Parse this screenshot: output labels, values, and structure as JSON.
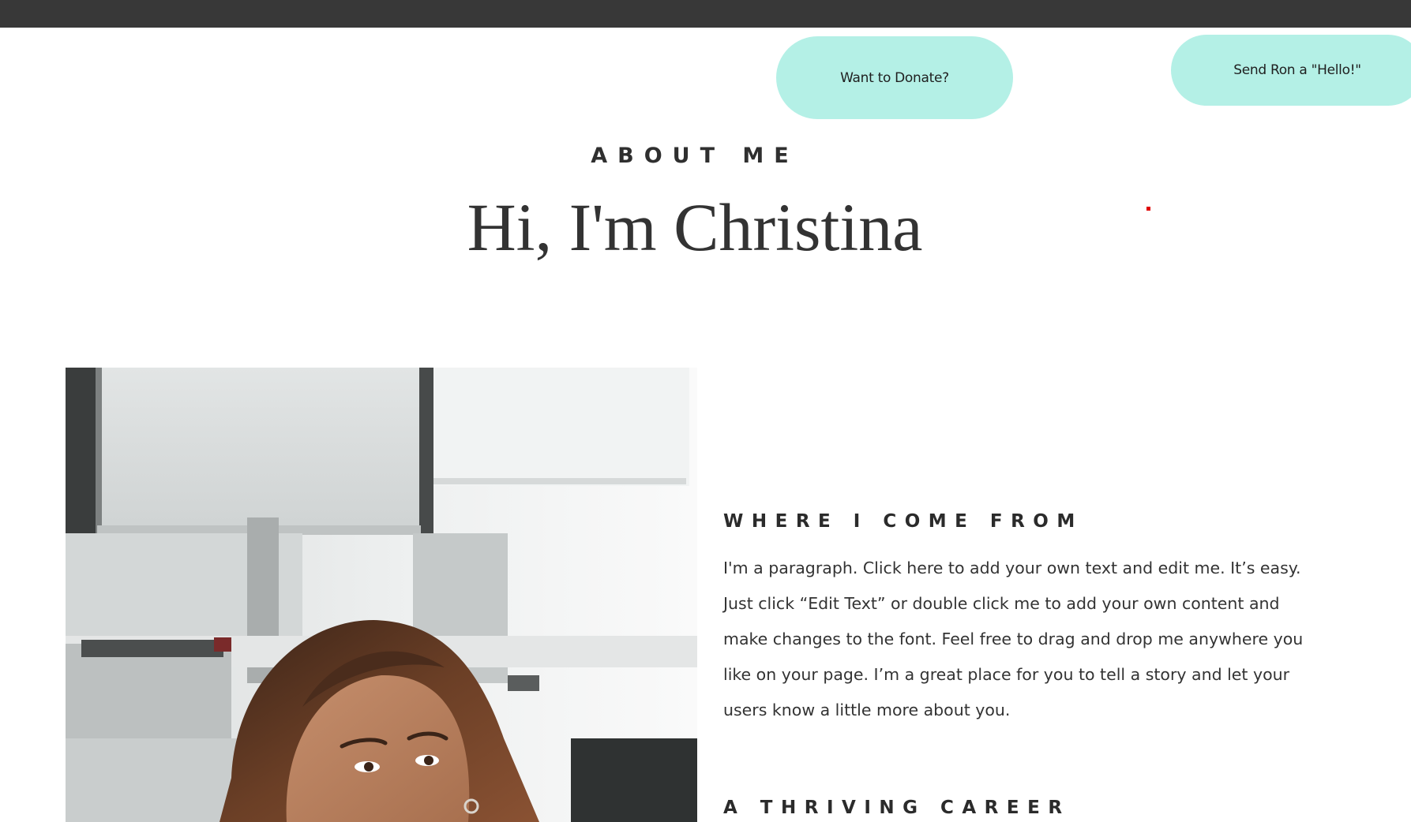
{
  "header": {
    "donate_label": "Want to Donate?",
    "hello_label": "Send Ron a \"Hello!\""
  },
  "intro": {
    "eyebrow": "ABOUT ME",
    "headline": "Hi, I'm Christina"
  },
  "portrait": {
    "alt": "Portrait photo of a smiling woman in an office"
  },
  "sections": [
    {
      "title": "WHERE I COME FROM",
      "body": "I'm a paragraph. Click here to add your own text and edit me. It’s easy. Just click “Edit Text” or double click me to add your own content and make changes to the font. Feel free to drag and drop me anywhere you like on your page. I’m a great place for you to tell a story and let your users know a little more about you."
    },
    {
      "title": "A THRIVING CAREER"
    }
  ],
  "colors": {
    "topbar": "#383838",
    "pill": "#b4f0e6",
    "text": "#2f2f2f",
    "marker": "#e00000"
  }
}
